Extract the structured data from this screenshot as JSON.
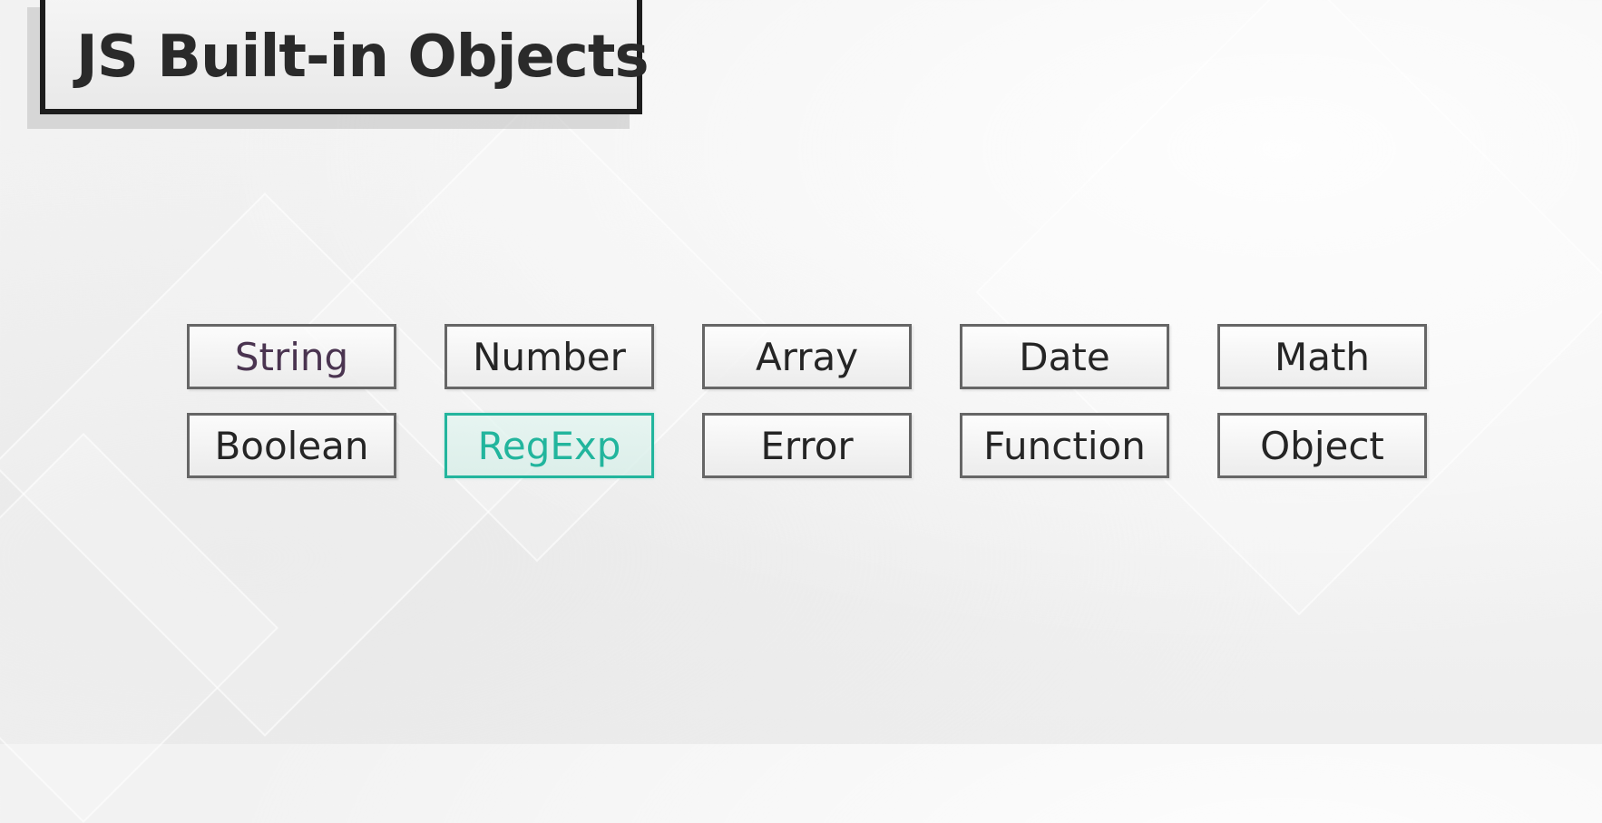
{
  "title": "JS Built-in Objects",
  "objects": [
    {
      "label": "String",
      "highlighted": false
    },
    {
      "label": "Number",
      "highlighted": false
    },
    {
      "label": "Array",
      "highlighted": false
    },
    {
      "label": "Date",
      "highlighted": false
    },
    {
      "label": "Math",
      "highlighted": false
    },
    {
      "label": "Boolean",
      "highlighted": false
    },
    {
      "label": "RegExp",
      "highlighted": true
    },
    {
      "label": "Error",
      "highlighted": false
    },
    {
      "label": "Function",
      "highlighted": false
    },
    {
      "label": "Object",
      "highlighted": false
    }
  ],
  "colors": {
    "highlight": "#22b59d",
    "box_border": "#666666",
    "title_border": "#1d1d1d",
    "text": "#252525"
  }
}
